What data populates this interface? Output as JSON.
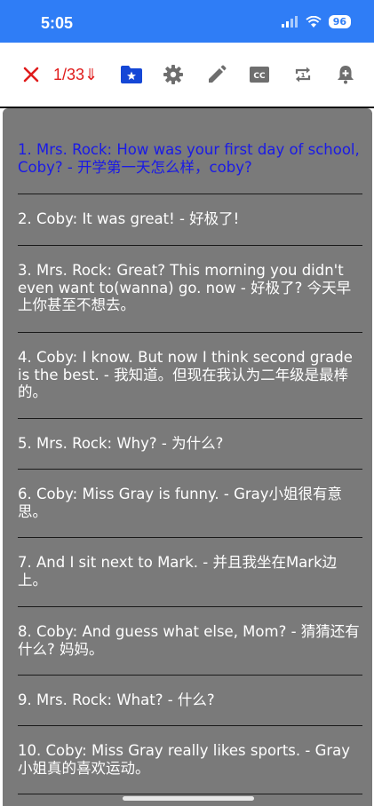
{
  "status_bar": {
    "time": "5:05",
    "battery": "96"
  },
  "toolbar": {
    "counter": "1/33⇓",
    "icons": [
      "close-icon",
      "star-folder-icon",
      "gear-icon",
      "pencil-icon",
      "closed-caption-icon",
      "repeat-one-icon",
      "add-alarm-icon"
    ]
  },
  "colors": {
    "status_bar": "#2f7df6",
    "accent_red": "#e01b1b",
    "active_text": "#1a1ae6",
    "panel": "#7a7a7a",
    "icon_gray": "#6e6e6e"
  },
  "items": [
    "1. Mrs. Rock: How was your first day of school, Coby?   - 开学第一天怎么样，coby?",
    "2. Coby: It was great!   - 好极了!",
    "3. Mrs. Rock: Great? This morning you didn't even want to(wanna) go. now   - 好极了? 今天早上你甚至不想去。",
    "4. Coby: I know. But now I think second grade is the best.   - 我知道。但现在我认为二年级是最棒的。",
    "5. Mrs. Rock: Why?   - 为什么?",
    "6. Coby: Miss Gray is funny.   - Gray小姐很有意思。",
    "7. And I sit next to Mark.   - 并且我坐在Mark边上。",
    "8. Coby: And guess what else, Mom?   - 猜猜还有什么? 妈妈。",
    "9. Mrs. Rock: What?   - 什么?",
    "10. Coby: Miss Gray really likes sports.   - Gray小姐真的喜欢运动。"
  ]
}
